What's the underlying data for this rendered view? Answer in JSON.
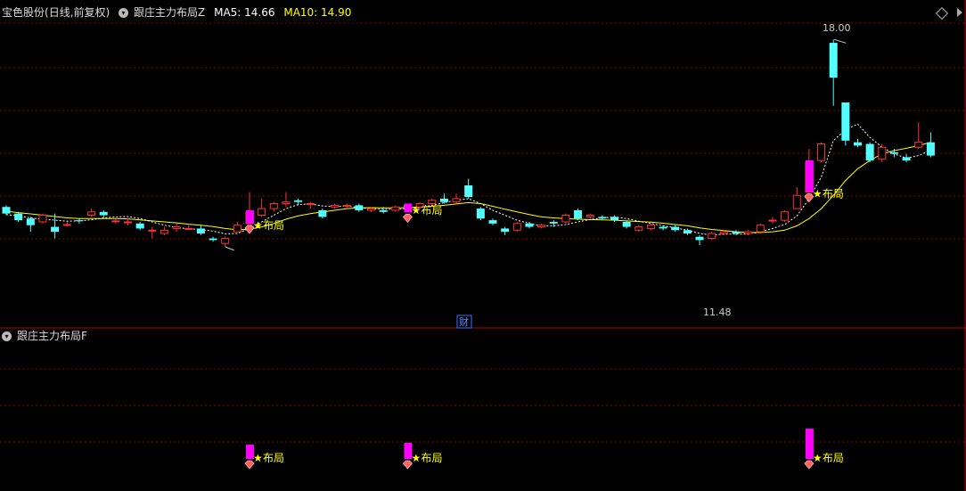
{
  "header": {
    "stock_name": "宝色股份",
    "period": "(日线,前复权)",
    "indicator_main": "跟庄主力布局Z",
    "ma5_label": "MA5: 14.66",
    "ma10_label": "MA10: 14.90",
    "indicator_sub": "跟庄主力布局F"
  },
  "colors": {
    "up": "#ff3232",
    "down": "#54ffff",
    "ma5": "#ffffff",
    "ma10": "#ffff00",
    "signal": "#ff00ff",
    "grid": "#8b0000",
    "star": "#ffff00"
  },
  "icons": [
    "chevron-down-icon",
    "diamond-icon",
    "scroll-right-icon",
    "star-icon",
    "gem-icon"
  ],
  "chart_data": {
    "type": "candlestick",
    "ylim": [
      10.0,
      18.6
    ],
    "annotations": {
      "high_label": "18.00",
      "low_label": "11.48",
      "fin_marker": "财",
      "signal_text": "布局"
    },
    "candles": [
      [
        12.95,
        12.75,
        13.0,
        12.7
      ],
      [
        12.75,
        12.55,
        12.8,
        12.5
      ],
      [
        12.6,
        12.4,
        12.65,
        12.2
      ],
      [
        12.5,
        12.7,
        12.75,
        12.45
      ],
      [
        12.35,
        12.2,
        12.75,
        12.0
      ],
      [
        12.4,
        12.42,
        12.5,
        12.35
      ],
      [
        12.55,
        12.52,
        12.6,
        12.45
      ],
      [
        12.7,
        12.8,
        12.9,
        12.65
      ],
      [
        12.8,
        12.7,
        12.85,
        12.6
      ],
      [
        12.52,
        12.53,
        12.6,
        12.45
      ],
      [
        12.5,
        12.5,
        12.6,
        12.4
      ],
      [
        12.45,
        12.3,
        12.5,
        12.25
      ],
      [
        12.25,
        12.25,
        12.35,
        12.0
      ],
      [
        12.15,
        12.25,
        12.35,
        12.1
      ],
      [
        12.3,
        12.35,
        12.45,
        12.2
      ],
      [
        12.3,
        12.3,
        12.4,
        12.25
      ],
      [
        12.3,
        12.15,
        12.4,
        12.1
      ],
      [
        12.0,
        11.95,
        12.05,
        11.9
      ],
      [
        11.85,
        12.0,
        12.05,
        11.75
      ],
      [
        12.2,
        12.4,
        12.5,
        12.2
      ],
      [
        12.45,
        12.8,
        13.4,
        12.45
      ],
      [
        12.7,
        12.9,
        13.2,
        12.65
      ],
      [
        12.9,
        13.05,
        13.1,
        12.8
      ],
      [
        13.05,
        13.1,
        13.4,
        12.95
      ],
      [
        13.15,
        13.1,
        13.2,
        13.0
      ],
      [
        13.05,
        13.05,
        13.1,
        12.9
      ],
      [
        12.85,
        12.65,
        12.9,
        12.6
      ],
      [
        12.95,
        13.0,
        13.05,
        12.9
      ],
      [
        13.0,
        13.0,
        13.05,
        12.9
      ],
      [
        13.0,
        12.85,
        13.05,
        12.8
      ],
      [
        12.85,
        12.9,
        12.95,
        12.8
      ],
      [
        12.85,
        12.8,
        12.95,
        12.75
      ],
      [
        12.85,
        12.95,
        13.0,
        12.8
      ],
      [
        13.0,
        12.9,
        13.05,
        12.85
      ],
      [
        12.95,
        13.05,
        13.1,
        12.9
      ],
      [
        13.05,
        13.15,
        13.2,
        13.0
      ],
      [
        13.2,
        13.1,
        13.35,
        13.05
      ],
      [
        13.1,
        13.2,
        13.35,
        13.05
      ],
      [
        13.6,
        13.25,
        13.8,
        13.2
      ],
      [
        12.9,
        12.6,
        12.95,
        12.55
      ],
      [
        12.55,
        12.45,
        12.6,
        12.4
      ],
      [
        12.3,
        12.2,
        12.35,
        12.1
      ],
      [
        12.25,
        12.45,
        12.5,
        12.2
      ],
      [
        12.45,
        12.35,
        12.5,
        12.3
      ],
      [
        12.35,
        12.4,
        12.45,
        12.3
      ],
      [
        12.5,
        12.45,
        12.55,
        12.35
      ],
      [
        12.5,
        12.7,
        12.75,
        12.45
      ],
      [
        12.85,
        12.6,
        12.9,
        12.55
      ],
      [
        12.65,
        12.7,
        12.75,
        12.6
      ],
      [
        12.65,
        12.6,
        12.7,
        12.55
      ],
      [
        12.65,
        12.55,
        12.7,
        12.5
      ],
      [
        12.5,
        12.35,
        12.55,
        12.3
      ],
      [
        12.25,
        12.35,
        12.4,
        12.2
      ],
      [
        12.3,
        12.4,
        12.45,
        12.25
      ],
      [
        12.35,
        12.3,
        12.4,
        12.25
      ],
      [
        12.35,
        12.25,
        12.4,
        12.2
      ],
      [
        12.25,
        12.15,
        12.3,
        12.1
      ],
      [
        12.05,
        11.95,
        12.1,
        11.8
      ],
      [
        12.0,
        12.15,
        12.2,
        11.95
      ],
      [
        12.15,
        12.2,
        12.25,
        12.1
      ],
      [
        12.2,
        12.15,
        12.25,
        12.1
      ],
      [
        12.15,
        12.2,
        12.25,
        12.1
      ],
      [
        12.2,
        12.4,
        12.45,
        12.15
      ],
      [
        12.55,
        12.55,
        12.65,
        12.45
      ],
      [
        12.55,
        12.8,
        12.85,
        12.5
      ],
      [
        12.9,
        13.3,
        13.55,
        12.9
      ],
      [
        13.4,
        14.3,
        14.7,
        13.35
      ],
      [
        14.35,
        14.85,
        14.9,
        14.3
      ],
      [
        17.9,
        16.85,
        18.0,
        16.0
      ],
      [
        16.1,
        14.95,
        16.1,
        14.8
      ],
      [
        14.9,
        14.8,
        15.0,
        14.75
      ],
      [
        14.85,
        14.35,
        14.9,
        14.3
      ],
      [
        14.4,
        14.75,
        14.85,
        14.3
      ],
      [
        14.6,
        14.55,
        14.7,
        14.45
      ],
      [
        14.45,
        14.35,
        14.55,
        14.3
      ],
      [
        14.75,
        14.9,
        15.5,
        14.7
      ],
      [
        14.9,
        14.5,
        15.2,
        14.45
      ]
    ],
    "ma5": [
      12.72,
      12.68,
      12.62,
      12.58,
      12.55,
      12.52,
      12.53,
      12.56,
      12.62,
      12.65,
      12.66,
      12.6,
      12.5,
      12.4,
      12.33,
      12.29,
      12.27,
      12.22,
      12.14,
      12.15,
      12.3,
      12.5,
      12.7,
      12.9,
      13.02,
      13.04,
      12.98,
      12.96,
      12.98,
      12.93,
      12.9,
      12.88,
      12.88,
      12.9,
      12.93,
      13.0,
      13.08,
      13.15,
      13.2,
      13.05,
      12.85,
      12.7,
      12.55,
      12.45,
      12.38,
      12.38,
      12.42,
      12.5,
      12.57,
      12.62,
      12.65,
      12.6,
      12.52,
      12.45,
      12.38,
      12.32,
      12.25,
      12.15,
      12.1,
      12.13,
      12.13,
      12.13,
      12.2,
      12.3,
      12.42,
      12.68,
      13.2,
      13.85,
      14.95,
      15.28,
      15.45,
      15.05,
      14.75,
      14.55,
      14.42,
      14.5,
      14.66
    ],
    "ma10": [
      12.82,
      12.78,
      12.74,
      12.7,
      12.66,
      12.62,
      12.6,
      12.6,
      12.6,
      12.6,
      12.59,
      12.56,
      12.53,
      12.5,
      12.47,
      12.43,
      12.4,
      12.36,
      12.3,
      12.26,
      12.28,
      12.35,
      12.45,
      12.58,
      12.68,
      12.75,
      12.8,
      12.85,
      12.9,
      12.92,
      12.93,
      12.92,
      12.92,
      12.93,
      12.95,
      12.97,
      13.0,
      13.04,
      13.08,
      13.05,
      12.97,
      12.88,
      12.8,
      12.72,
      12.65,
      12.62,
      12.6,
      12.58,
      12.57,
      12.56,
      12.55,
      12.53,
      12.51,
      12.49,
      12.46,
      12.42,
      12.38,
      12.32,
      12.27,
      12.24,
      12.2,
      12.18,
      12.18,
      12.2,
      12.25,
      12.38,
      12.6,
      12.9,
      13.3,
      13.75,
      14.1,
      14.35,
      14.55,
      14.65,
      14.72,
      14.8,
      14.9
    ],
    "signals": [
      {
        "index": 20,
        "text": "布局"
      },
      {
        "index": 33,
        "text": "布局"
      },
      {
        "index": 66,
        "text": "布局"
      }
    ]
  }
}
